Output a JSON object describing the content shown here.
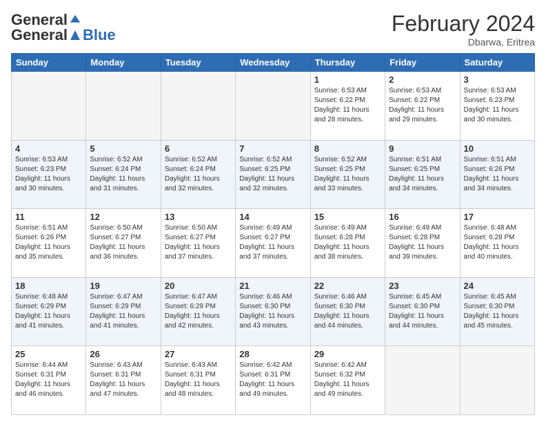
{
  "header": {
    "logo_general": "General",
    "logo_blue": "Blue",
    "month_year": "February 2024",
    "location": "Dbarwa, Eritrea"
  },
  "days_of_week": [
    "Sunday",
    "Monday",
    "Tuesday",
    "Wednesday",
    "Thursday",
    "Friday",
    "Saturday"
  ],
  "weeks": [
    [
      {
        "day": "",
        "info": ""
      },
      {
        "day": "",
        "info": ""
      },
      {
        "day": "",
        "info": ""
      },
      {
        "day": "",
        "info": ""
      },
      {
        "day": "1",
        "info": "Sunrise: 6:53 AM\nSunset: 6:22 PM\nDaylight: 11 hours and 28 minutes."
      },
      {
        "day": "2",
        "info": "Sunrise: 6:53 AM\nSunset: 6:22 PM\nDaylight: 11 hours and 29 minutes."
      },
      {
        "day": "3",
        "info": "Sunrise: 6:53 AM\nSunset: 6:23 PM\nDaylight: 11 hours and 30 minutes."
      }
    ],
    [
      {
        "day": "4",
        "info": "Sunrise: 6:53 AM\nSunset: 6:23 PM\nDaylight: 11 hours and 30 minutes."
      },
      {
        "day": "5",
        "info": "Sunrise: 6:52 AM\nSunset: 6:24 PM\nDaylight: 11 hours and 31 minutes."
      },
      {
        "day": "6",
        "info": "Sunrise: 6:52 AM\nSunset: 6:24 PM\nDaylight: 11 hours and 32 minutes."
      },
      {
        "day": "7",
        "info": "Sunrise: 6:52 AM\nSunset: 6:25 PM\nDaylight: 11 hours and 32 minutes."
      },
      {
        "day": "8",
        "info": "Sunrise: 6:52 AM\nSunset: 6:25 PM\nDaylight: 11 hours and 33 minutes."
      },
      {
        "day": "9",
        "info": "Sunrise: 6:51 AM\nSunset: 6:25 PM\nDaylight: 11 hours and 34 minutes."
      },
      {
        "day": "10",
        "info": "Sunrise: 6:51 AM\nSunset: 6:26 PM\nDaylight: 11 hours and 34 minutes."
      }
    ],
    [
      {
        "day": "11",
        "info": "Sunrise: 6:51 AM\nSunset: 6:26 PM\nDaylight: 11 hours and 35 minutes."
      },
      {
        "day": "12",
        "info": "Sunrise: 6:50 AM\nSunset: 6:27 PM\nDaylight: 11 hours and 36 minutes."
      },
      {
        "day": "13",
        "info": "Sunrise: 6:50 AM\nSunset: 6:27 PM\nDaylight: 11 hours and 37 minutes."
      },
      {
        "day": "14",
        "info": "Sunrise: 6:49 AM\nSunset: 6:27 PM\nDaylight: 11 hours and 37 minutes."
      },
      {
        "day": "15",
        "info": "Sunrise: 6:49 AM\nSunset: 6:28 PM\nDaylight: 11 hours and 38 minutes."
      },
      {
        "day": "16",
        "info": "Sunrise: 6:49 AM\nSunset: 6:28 PM\nDaylight: 11 hours and 39 minutes."
      },
      {
        "day": "17",
        "info": "Sunrise: 6:48 AM\nSunset: 6:28 PM\nDaylight: 11 hours and 40 minutes."
      }
    ],
    [
      {
        "day": "18",
        "info": "Sunrise: 6:48 AM\nSunset: 6:29 PM\nDaylight: 11 hours and 41 minutes."
      },
      {
        "day": "19",
        "info": "Sunrise: 6:47 AM\nSunset: 6:29 PM\nDaylight: 11 hours and 41 minutes."
      },
      {
        "day": "20",
        "info": "Sunrise: 6:47 AM\nSunset: 6:29 PM\nDaylight: 11 hours and 42 minutes."
      },
      {
        "day": "21",
        "info": "Sunrise: 6:46 AM\nSunset: 6:30 PM\nDaylight: 11 hours and 43 minutes."
      },
      {
        "day": "22",
        "info": "Sunrise: 6:46 AM\nSunset: 6:30 PM\nDaylight: 11 hours and 44 minutes."
      },
      {
        "day": "23",
        "info": "Sunrise: 6:45 AM\nSunset: 6:30 PM\nDaylight: 11 hours and 44 minutes."
      },
      {
        "day": "24",
        "info": "Sunrise: 6:45 AM\nSunset: 6:30 PM\nDaylight: 11 hours and 45 minutes."
      }
    ],
    [
      {
        "day": "25",
        "info": "Sunrise: 6:44 AM\nSunset: 6:31 PM\nDaylight: 11 hours and 46 minutes."
      },
      {
        "day": "26",
        "info": "Sunrise: 6:43 AM\nSunset: 6:31 PM\nDaylight: 11 hours and 47 minutes."
      },
      {
        "day": "27",
        "info": "Sunrise: 6:43 AM\nSunset: 6:31 PM\nDaylight: 11 hours and 48 minutes."
      },
      {
        "day": "28",
        "info": "Sunrise: 6:42 AM\nSunset: 6:31 PM\nDaylight: 11 hours and 49 minutes."
      },
      {
        "day": "29",
        "info": "Sunrise: 6:42 AM\nSunset: 6:32 PM\nDaylight: 11 hours and 49 minutes."
      },
      {
        "day": "",
        "info": ""
      },
      {
        "day": "",
        "info": ""
      }
    ]
  ]
}
